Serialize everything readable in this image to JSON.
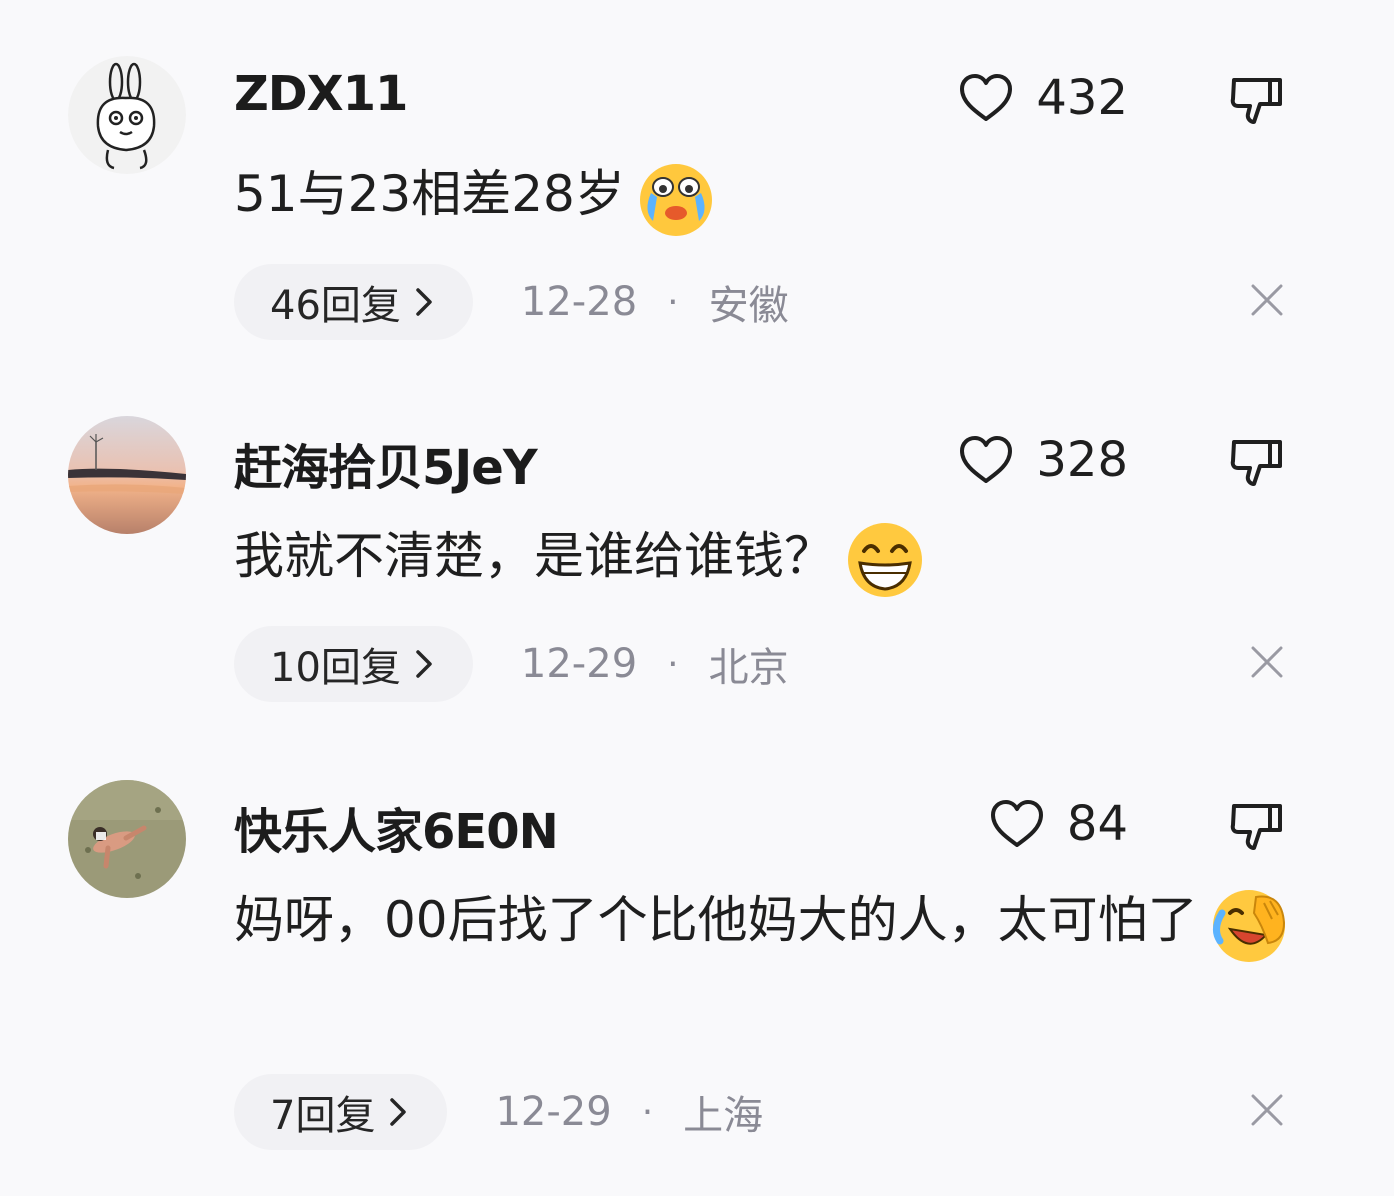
{
  "comments": [
    {
      "username": "ZDX11",
      "likes": "432",
      "text": "51与23相差28岁",
      "emoji": "crying-face-icon",
      "replies": "46回复",
      "date": "12-28",
      "separator": "·",
      "location": "安徽"
    },
    {
      "username": "赶海拾贝5JeY",
      "likes": "328",
      "text": "我就不清楚，是谁给谁钱？",
      "emoji": "grinning-face-icon",
      "replies": "10回复",
      "date": "12-29",
      "separator": "·",
      "location": "北京"
    },
    {
      "username": "快乐人家6E0N",
      "likes": "84",
      "text": "妈呀，00后找了个比他妈大的人，太可怕了",
      "emoji": "laughing-crying-face-icon",
      "replies": "7回复",
      "date": "12-29",
      "separator": "·",
      "location": "上海"
    }
  ],
  "colors": {
    "background": "#f9f9fb",
    "pill": "#f1f1f4",
    "muted": "#8a8a95"
  }
}
